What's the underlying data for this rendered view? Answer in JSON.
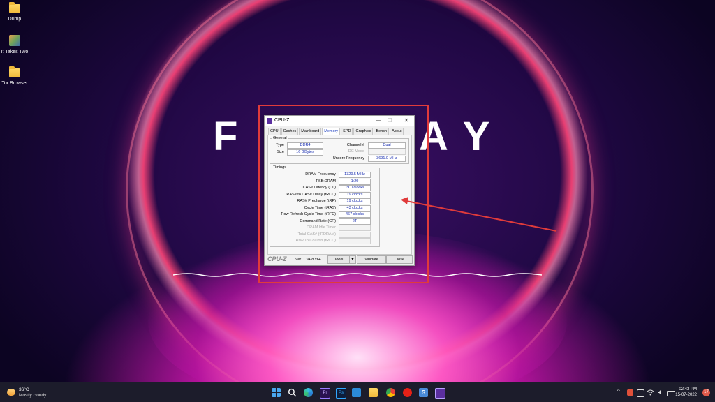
{
  "desktop": {
    "icons": [
      {
        "label": "Dump",
        "icon": "folder-icon"
      },
      {
        "label": "It Takes Two",
        "icon": "game-icon"
      },
      {
        "label": "Tor Browser",
        "icon": "folder-icon"
      }
    ],
    "wallpaper_letters": {
      "left": "F",
      "right": "A Y"
    }
  },
  "cpuz": {
    "title": "CPU-Z",
    "window_buttons": {
      "minimize": "—",
      "maximize": "☐",
      "close": "✕"
    },
    "tabs": [
      "CPU",
      "Caches",
      "Mainboard",
      "Memory",
      "SPD",
      "Graphics",
      "Bench",
      "About"
    ],
    "active_tab": "Memory",
    "general": {
      "legend": "General",
      "type_label": "Type",
      "type_value": "DDR4",
      "size_label": "Size",
      "size_value": "16 GBytes",
      "channel_label": "Channel #",
      "channel_value": "Dual",
      "dcmode_label": "DC Mode",
      "dcmode_value": "",
      "uncore_label": "Uncore Frequency",
      "uncore_value": "3691.0 MHz"
    },
    "timings": {
      "legend": "Timings",
      "rows": [
        {
          "label": "DRAM Frequency",
          "value": "1329.5 MHz"
        },
        {
          "label": "FSB:DRAM",
          "value": "1:20"
        },
        {
          "label": "CAS# Latency (CL)",
          "value": "19.0 clocks"
        },
        {
          "label": "RAS# to CAS# Delay (tRCD)",
          "value": "19 clocks"
        },
        {
          "label": "RAS# Precharge (tRP)",
          "value": "19 clocks"
        },
        {
          "label": "Cycle Time (tRAS)",
          "value": "43 clocks"
        },
        {
          "label": "Row Refresh Cycle Time (tRFC)",
          "value": "467 clocks"
        },
        {
          "label": "Command Rate (CR)",
          "value": "2T"
        },
        {
          "label": "DRAM Idle Timer",
          "value": ""
        },
        {
          "label": "Total CAS# (tRDRAM)",
          "value": ""
        },
        {
          "label": "Row To Column (tRCD)",
          "value": ""
        }
      ]
    },
    "footer": {
      "logo": "CPU-Z",
      "version": "Ver. 1.94.8.x64",
      "tools_label": "Tools",
      "tools_arrow": "▼",
      "validate_label": "Validate",
      "close_label": "Close"
    }
  },
  "annotation": {
    "color": "#e03b3b"
  },
  "taskbar": {
    "weather_temp": "36°C",
    "weather_desc": "Mostly cloudy",
    "apps": [
      "windows-start-icon",
      "search-icon",
      "edge-icon",
      "premiere-icon",
      "photoshop-icon",
      "terminal-icon",
      "file-explorer-icon",
      "chrome-icon",
      "youtube-icon",
      "sublime-icon",
      "cpuz-icon"
    ],
    "tray_chevron": "^",
    "time": "02:43 PM",
    "date": "15-07-2022",
    "notification_count": "17"
  }
}
